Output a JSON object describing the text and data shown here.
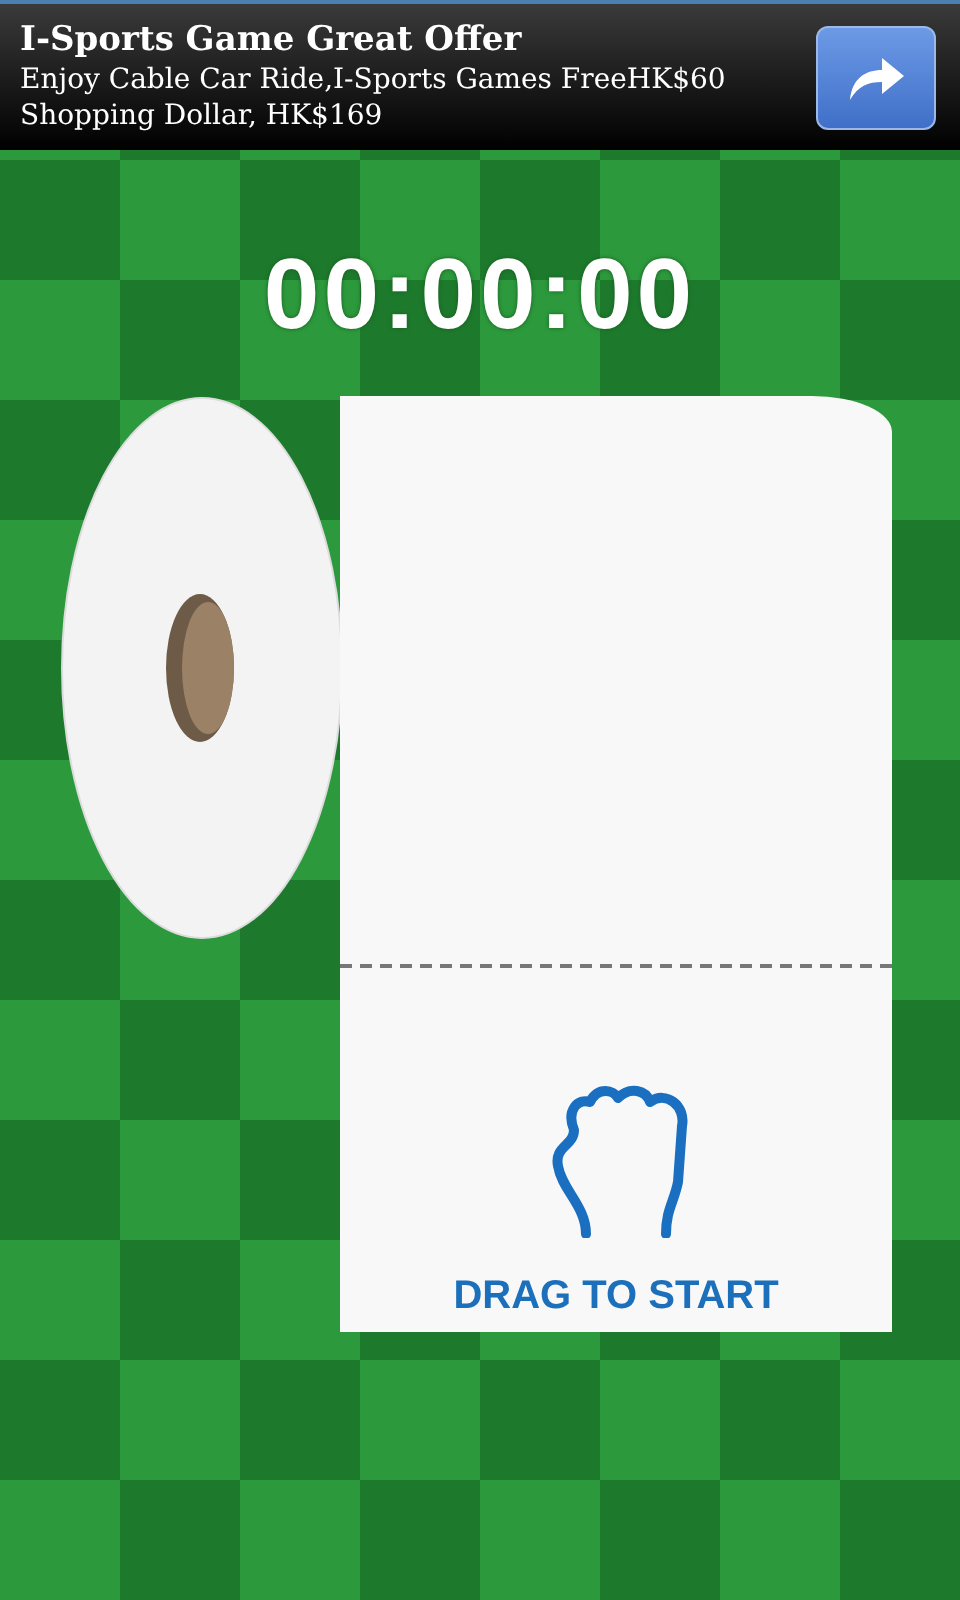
{
  "ad_banner": {
    "title": "I-Sports Game Great Offer",
    "text": "Enjoy Cable Car Ride,I-Sports Games FreeHK$60 Shopping Dollar, HK$169"
  },
  "timer": "00:00:00",
  "paper": {
    "label": "DRAG TO START"
  }
}
